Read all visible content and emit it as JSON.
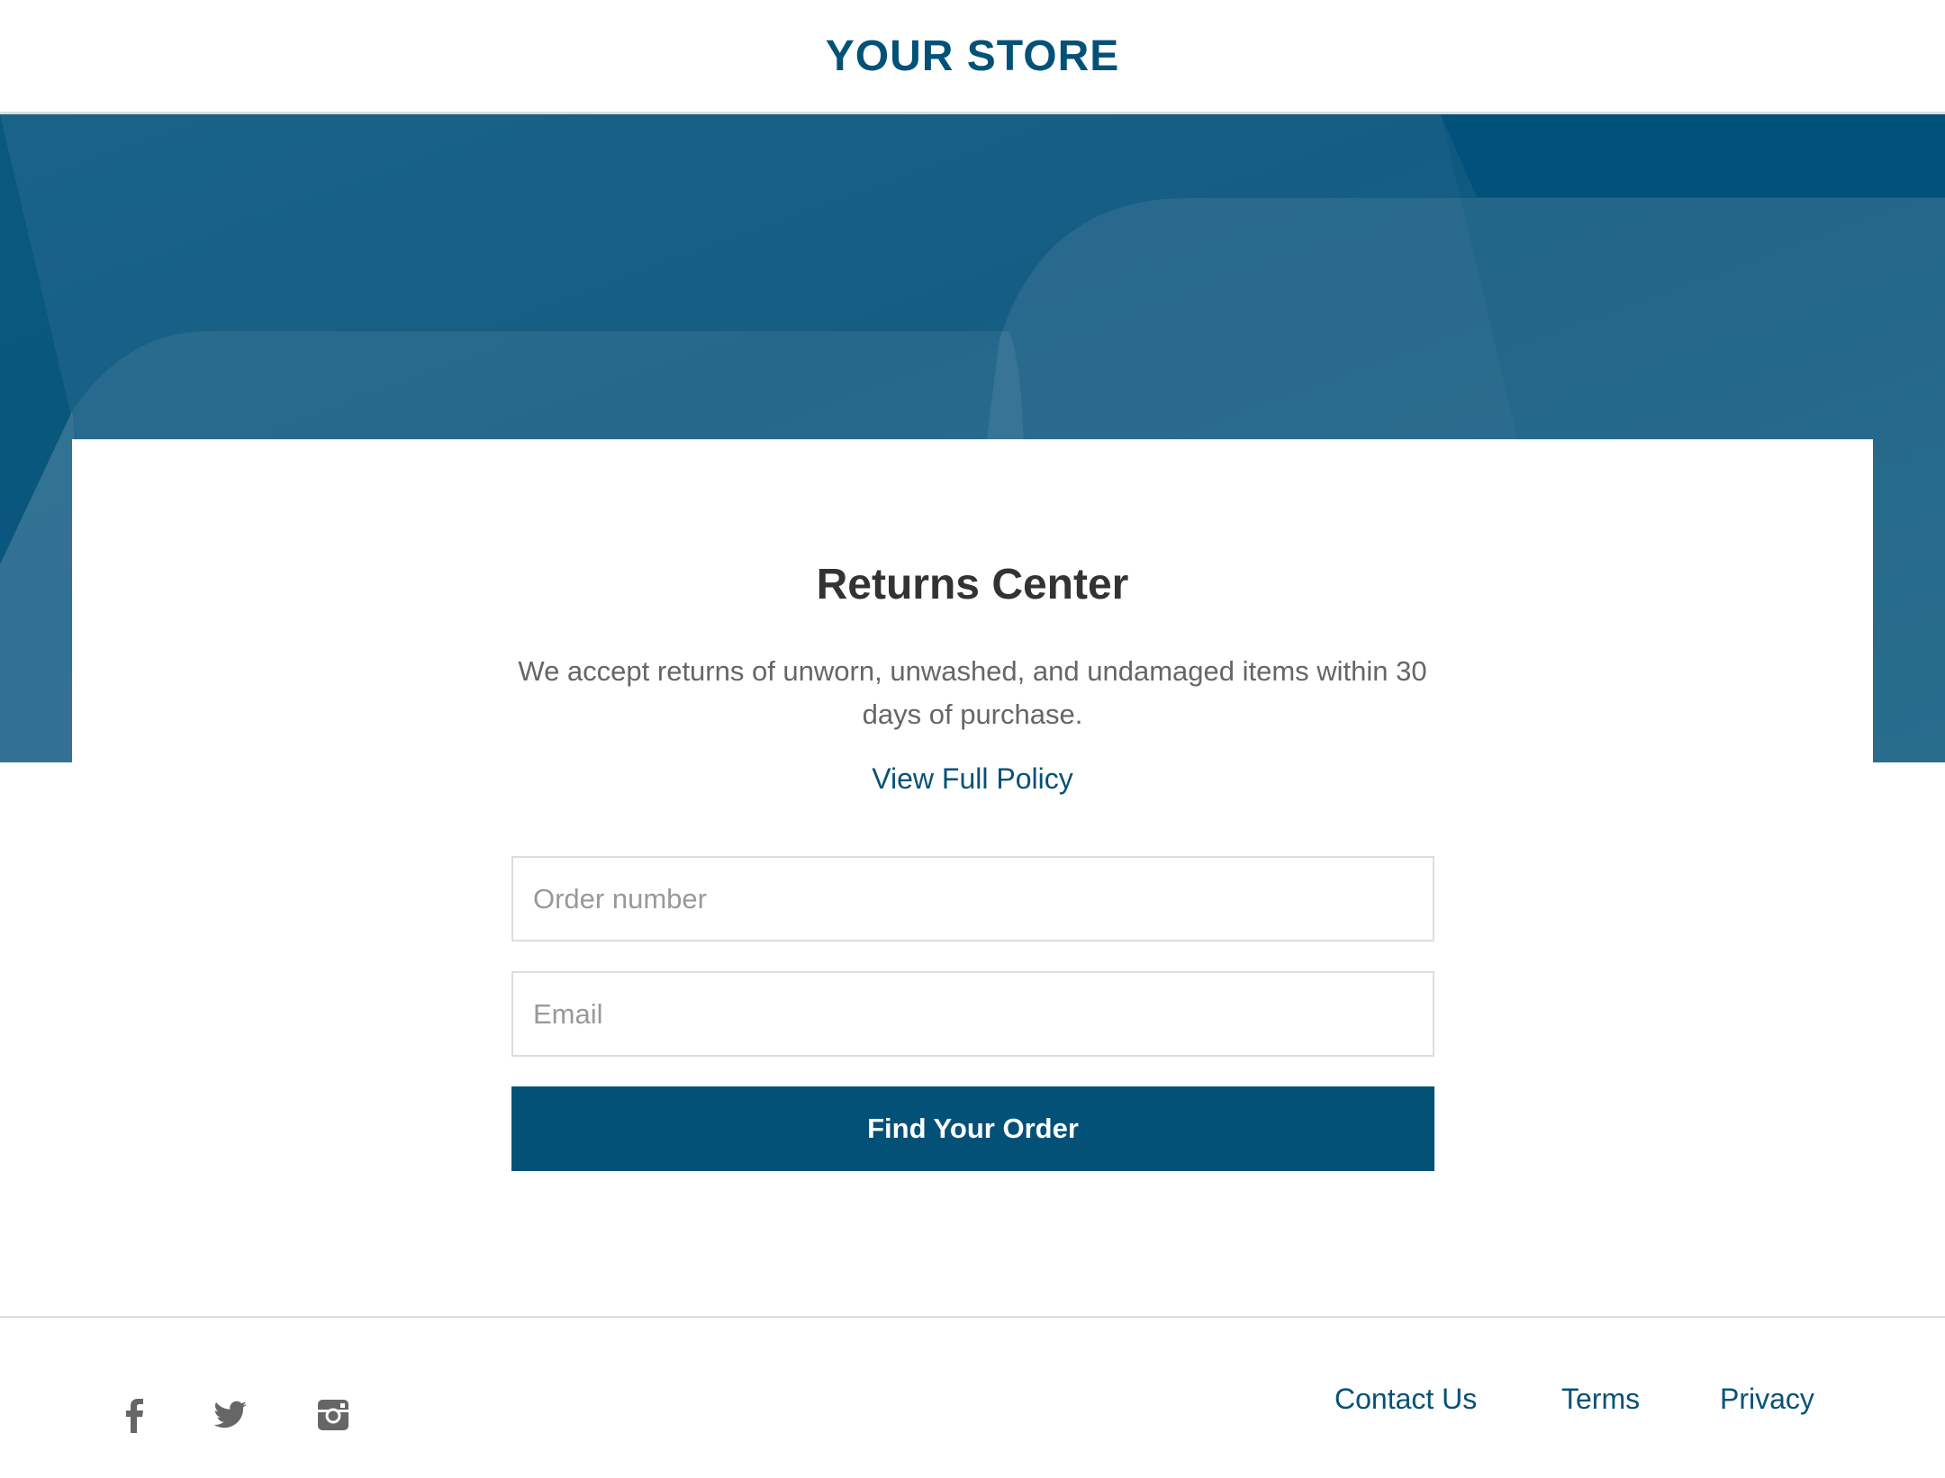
{
  "header": {
    "logo": "YOUR STORE"
  },
  "colors": {
    "brand": "#045178",
    "text": "#333333",
    "muted": "#666666",
    "icon": "#666666"
  },
  "main": {
    "title": "Returns Center",
    "description": "We accept returns of unworn, unwashed, and undamaged items within 30 days of purchase.",
    "policy_link": "View Full Policy",
    "order_placeholder": "Order number",
    "email_placeholder": "Email",
    "submit_label": "Find Your Order"
  },
  "footer": {
    "social": [
      "facebook-icon",
      "twitter-icon",
      "instagram-icon"
    ],
    "links": [
      "Contact Us",
      "Terms",
      "Privacy"
    ]
  }
}
